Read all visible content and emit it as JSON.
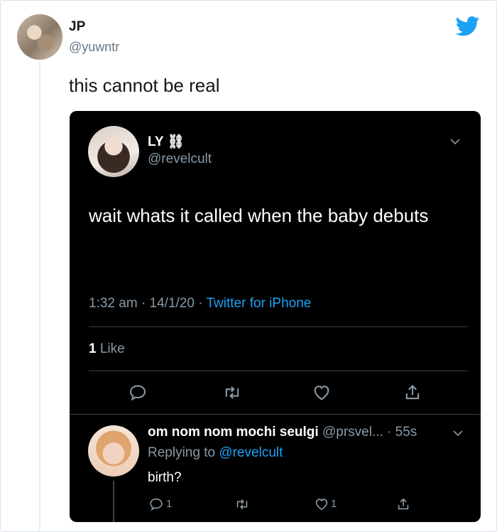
{
  "tweet": {
    "author_name": "JP",
    "author_handle": "@yuwntr",
    "text": "this cannot be real",
    "brand_icon": "twitter-bird-icon",
    "brand_color": "#1da1f2"
  },
  "quoted_tweet": {
    "author_name": "LY ⛓",
    "author_handle": "@revelcult",
    "text": "wait whats it called when the baby debuts",
    "time": "1:32 am",
    "date": "14/1/20",
    "separator": "·",
    "source": "Twitter for iPhone",
    "likes_count": "1",
    "likes_label": "Like",
    "actions": [
      "reply-icon",
      "retweet-icon",
      "like-icon",
      "share-icon"
    ],
    "background": "#000000"
  },
  "reply": {
    "author_name": "om nom nom mochi seulgi",
    "author_handle": "@prsvel...",
    "time": "· 55s",
    "replying_prefix": "Replying to",
    "replying_to": "@revelcult",
    "text": "birth?",
    "reply_count": "1",
    "like_count": "1"
  }
}
